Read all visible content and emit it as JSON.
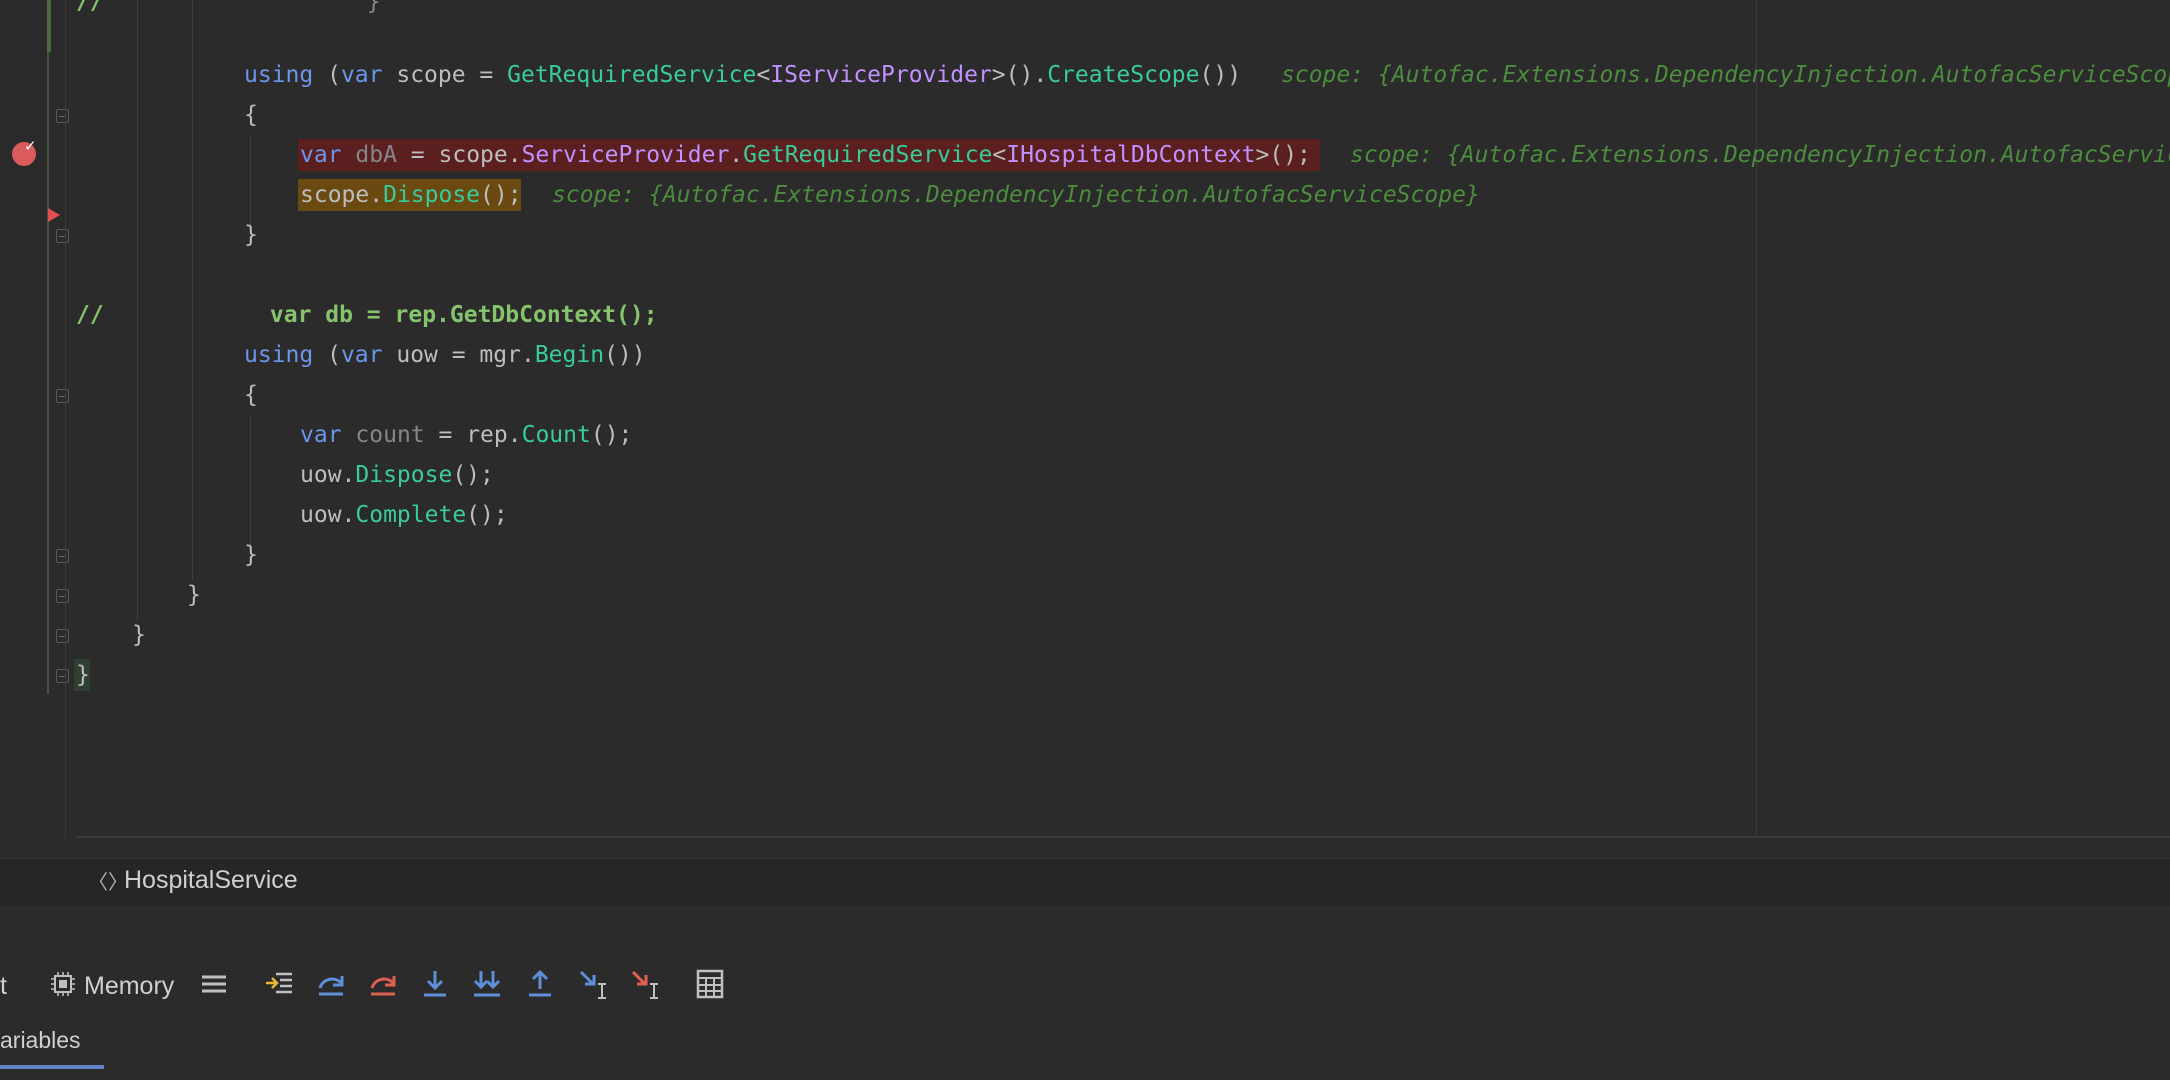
{
  "editor": {
    "lines": [
      {
        "segments": [
          {
            "t": "//",
            "c": "cm"
          },
          {
            "t": "                   }",
            "c": "dim"
          }
        ]
      },
      {
        "segments": [
          {
            "t": "using",
            "c": "kw"
          },
          {
            "t": " (",
            "c": "pu"
          },
          {
            "t": "var",
            "c": "kw"
          },
          {
            "t": " scope = ",
            "c": "id"
          },
          {
            "t": "GetRequiredService",
            "c": "fn"
          },
          {
            "t": "<",
            "c": "pu"
          },
          {
            "t": "IServiceProvider",
            "c": "ty"
          },
          {
            "t": ">().",
            "c": "pu"
          },
          {
            "t": "CreateScope",
            "c": "fn"
          },
          {
            "t": "())",
            "c": "pu"
          }
        ],
        "hint": "scope: {Autofac.Extensions.DependencyInjection.AutofacServiceScope}"
      },
      {
        "segments": [
          {
            "t": "{",
            "c": "pu"
          }
        ]
      },
      {
        "segments": [
          {
            "t": "var",
            "c": "kw"
          },
          {
            "t": " ",
            "c": "id"
          },
          {
            "t": "dbA",
            "c": "dim"
          },
          {
            "t": " = scope.",
            "c": "id"
          },
          {
            "t": "ServiceProvider",
            "c": "ty"
          },
          {
            "t": ".",
            "c": "pu"
          },
          {
            "t": "GetRequiredService",
            "c": "fn"
          },
          {
            "t": "<",
            "c": "pu"
          },
          {
            "t": "IHospitalDbContext",
            "c": "ty"
          },
          {
            "t": ">();",
            "c": "pu"
          }
        ],
        "hint": "scope: {Autofac.Extensions.DependencyInjection.AutofacServiceScope}"
      },
      {
        "segments": [
          {
            "t": "scope.",
            "c": "id"
          },
          {
            "t": "Dispose",
            "c": "fn"
          },
          {
            "t": "();",
            "c": "pu"
          }
        ],
        "hint": "scope: {Autofac.Extensions.DependencyInjection.AutofacServiceScope}"
      },
      {
        "segments": [
          {
            "t": "}",
            "c": "pu"
          }
        ]
      },
      {
        "segments": []
      },
      {
        "segments": [
          {
            "t": "//",
            "c": "cm"
          },
          {
            "t": "            var db = rep.GetDbContext();",
            "c": "cm"
          }
        ]
      },
      {
        "segments": [
          {
            "t": "using",
            "c": "kw"
          },
          {
            "t": " (",
            "c": "pu"
          },
          {
            "t": "var",
            "c": "kw"
          },
          {
            "t": " uow = mgr.",
            "c": "id"
          },
          {
            "t": "Begin",
            "c": "fn"
          },
          {
            "t": "())",
            "c": "pu"
          }
        ]
      },
      {
        "segments": [
          {
            "t": "{",
            "c": "pu"
          }
        ]
      },
      {
        "segments": [
          {
            "t": "var",
            "c": "kw"
          },
          {
            "t": " ",
            "c": "id"
          },
          {
            "t": "count",
            "c": "dim"
          },
          {
            "t": " = rep.",
            "c": "id"
          },
          {
            "t": "Count",
            "c": "fn"
          },
          {
            "t": "();",
            "c": "pu"
          }
        ]
      },
      {
        "segments": [
          {
            "t": "uow.",
            "c": "id"
          },
          {
            "t": "Dispose",
            "c": "fn"
          },
          {
            "t": "();",
            "c": "pu"
          }
        ]
      },
      {
        "segments": [
          {
            "t": "uow.",
            "c": "id"
          },
          {
            "t": "Complete",
            "c": "fn"
          },
          {
            "t": "();",
            "c": "pu"
          }
        ]
      },
      {
        "segments": [
          {
            "t": "}",
            "c": "pu"
          }
        ]
      },
      {
        "segments": [
          {
            "t": "}",
            "c": "pu"
          }
        ]
      },
      {
        "segments": [
          {
            "t": "}",
            "c": "pu"
          }
        ]
      },
      {
        "segments": [
          {
            "t": "}",
            "c": "pu"
          }
        ]
      }
    ]
  },
  "breadcrumb": {
    "icon": "namespace-braces-icon",
    "glyph": "〈〉",
    "label": "HospitalService"
  },
  "debug_toolbar": {
    "left_label": "t",
    "memory_label": "Memory",
    "icons": [
      "threads-list-icon",
      "show-execution-point-icon",
      "step-over-icon",
      "force-step-over-icon",
      "step-into-icon",
      "smart-step-into-icon",
      "step-out-icon",
      "run-to-cursor-icon",
      "force-run-to-cursor-icon",
      "evaluate-expression-icon"
    ]
  },
  "debug_tabs": {
    "variables_label": "ariables"
  },
  "colors": {
    "background": "#2b2b2b",
    "breakpoint": "#db5c5c",
    "exec_highlight": "#6a4a11",
    "tab_underline": "#5f82c7"
  }
}
